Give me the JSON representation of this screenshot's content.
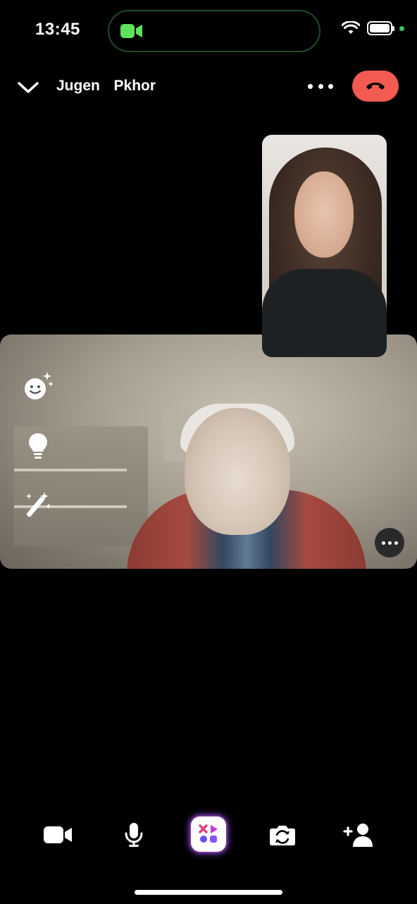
{
  "status_bar": {
    "time": "13:45",
    "icons": [
      "facetime-video-icon",
      "wifi-icon",
      "battery-icon",
      "camera-in-use-dot"
    ],
    "battery_level": 0.9,
    "accent_green": "#34c759"
  },
  "header": {
    "caller_name": "Jugen  Pkhor",
    "end_call_color": "#f25a52"
  },
  "call": {
    "remote_participant_tools": [
      "face-effects-icon",
      "lightbulb-icon",
      "magic-wand-icon"
    ],
    "self_view": "self-camera-preview"
  },
  "toolbar": {
    "items": [
      "video-camera-icon",
      "microphone-icon",
      "effects-apps-icon",
      "flip-camera-icon",
      "add-person-icon"
    ]
  }
}
